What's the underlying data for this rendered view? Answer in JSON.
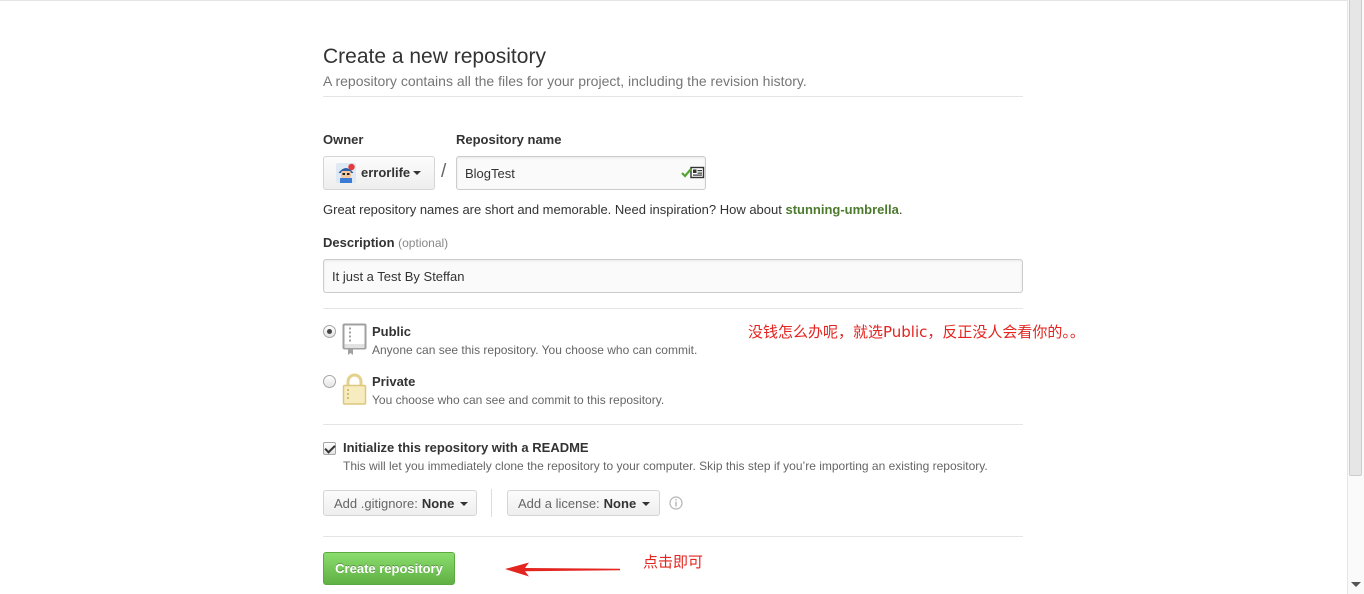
{
  "header": {
    "title": "Create a new repository",
    "subtitle": "A repository contains all the files for your project, including the revision history."
  },
  "owner": {
    "label": "Owner",
    "value": "errorlife"
  },
  "path_separator": "/",
  "repository_name": {
    "label": "Repository name",
    "value": "BlogTest"
  },
  "name_hint": {
    "text": "Great repository names are short and memorable. Need inspiration? How about ",
    "suggestion": "stunning-umbrella",
    "suffix": "."
  },
  "description": {
    "label": "Description",
    "optional": "(optional)",
    "value": "It just a Test By Steffan"
  },
  "visibility": {
    "options": [
      {
        "label": "Public",
        "description": "Anyone can see this repository. You choose who can commit.",
        "icon": "book-icon",
        "checked": true
      },
      {
        "label": "Private",
        "description": "You choose who can see and commit to this repository.",
        "icon": "lock-icon",
        "checked": false
      }
    ]
  },
  "readme": {
    "label": "Initialize this repository with a README",
    "description": "This will let you immediately clone the repository to your computer. Skip this step if you’re importing an existing repository.",
    "checked": true
  },
  "gitignore": {
    "prefix": "Add .gitignore:",
    "value": "None"
  },
  "license": {
    "prefix": "Add a license:",
    "value": "None"
  },
  "submit": {
    "label": "Create repository"
  },
  "annotations": {
    "visibility_note": "没钱怎么办呢，就选Public，反正没人会看你的。。",
    "submit_note": "点击即可"
  },
  "icons": {
    "owner_avatar": "avatar",
    "owner_caret": "caret-down-icon",
    "name_status": "check-icon",
    "info": "info-icon",
    "annotation_arrow": "arrow-left-icon"
  },
  "colors": {
    "accent_green": "#60b044",
    "suggestion_green": "#4b7a2c",
    "annotation_red": "#e3241f",
    "muted_text": "#767676"
  }
}
